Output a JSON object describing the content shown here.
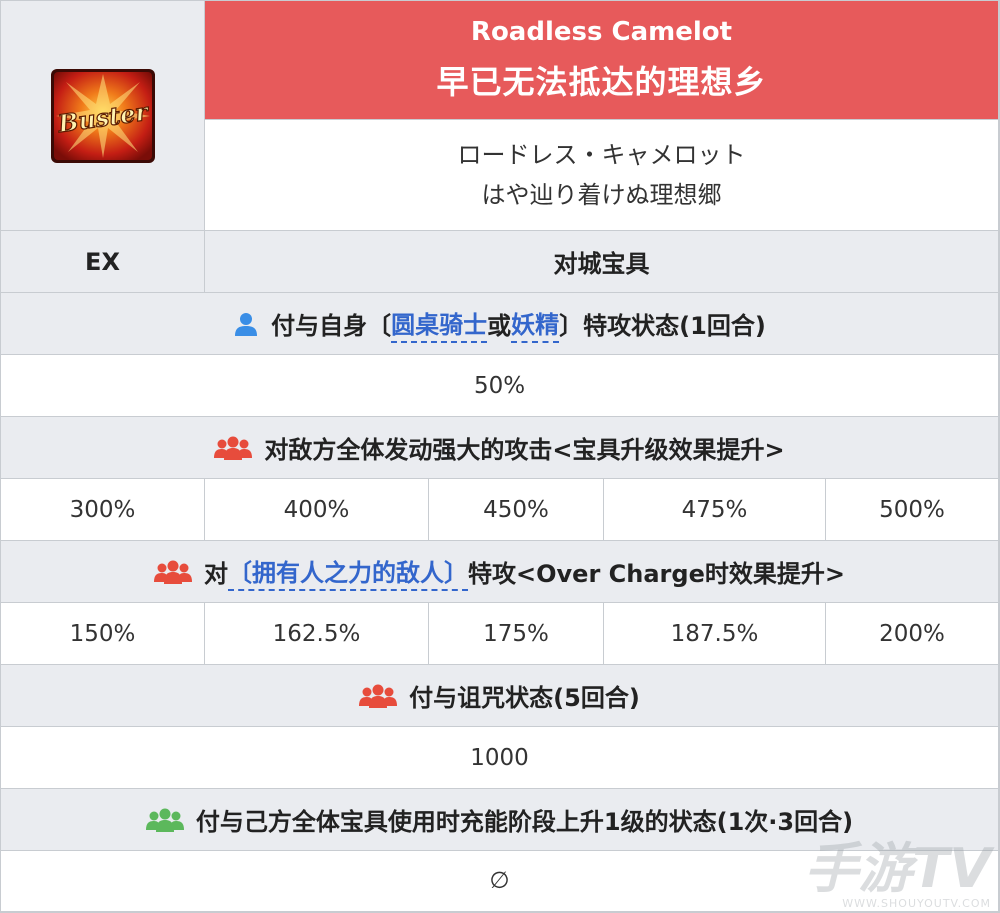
{
  "header": {
    "card_label": "Buster",
    "title_en": "Roadless Camelot",
    "title_cn": "早已无法抵达的理想乡",
    "title_jp_line1": "ロードレス・キャメロット",
    "title_jp_line2": "はや辿り着けぬ理想郷"
  },
  "rank_row": {
    "rank": "EX",
    "type": "对城宝具"
  },
  "effect1": {
    "prefix": "付与自身〔",
    "link1": "圆桌骑士",
    "mid": "或",
    "link2": "妖精",
    "suffix": "〕特攻状态(1回合)",
    "value": "50%"
  },
  "effect2": {
    "text": "对敌方全体发动强大的攻击<宝具升级效果提升>",
    "values": [
      "300%",
      "400%",
      "450%",
      "475%",
      "500%"
    ]
  },
  "effect3": {
    "prefix": "对",
    "link": "〔拥有人之力的敌人〕",
    "suffix": "特攻<Over Charge时效果提升>",
    "values": [
      "150%",
      "162.5%",
      "175%",
      "187.5%",
      "200%"
    ]
  },
  "effect4": {
    "text": "付与诅咒状态(5回合)",
    "value": "1000"
  },
  "effect5": {
    "text": "付与己方全体宝具使用时充能阶段上升1级的状态(1次·3回合)",
    "value": "∅"
  },
  "watermark": {
    "main": "手游TV",
    "sub": "WWW.SHOUYOUTV.COM"
  },
  "colors": {
    "title_bg": "#e75a5b",
    "self_icon": "#3a8ee6",
    "enemy_icon": "#e74c3c",
    "ally_icon": "#5cb85c",
    "link": "#3366cc"
  },
  "icons": {
    "card": "buster-card-icon",
    "self": "person-icon",
    "enemy": "group-icon",
    "ally": "group-icon"
  }
}
